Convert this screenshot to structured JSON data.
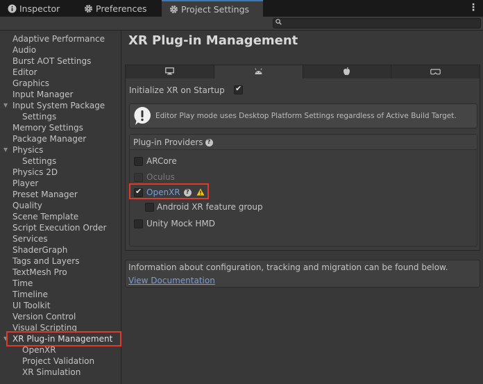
{
  "tabs": [
    {
      "label": "Inspector",
      "icon": "info-icon",
      "active": false
    },
    {
      "label": "Preferences",
      "icon": "gear-icon",
      "active": false
    },
    {
      "label": "Project Settings",
      "icon": "gear-icon",
      "active": true
    }
  ],
  "tab_menu": "⋮",
  "search": {
    "placeholder": "",
    "value": ""
  },
  "sidebar": {
    "items": [
      {
        "label": "Adaptive Performance"
      },
      {
        "label": "Audio"
      },
      {
        "label": "Burst AOT Settings"
      },
      {
        "label": "Editor"
      },
      {
        "label": "Graphics"
      },
      {
        "label": "Input Manager"
      },
      {
        "label": "Input System Package",
        "expanded": true
      },
      {
        "label": "Settings"
      },
      {
        "label": "Memory Settings"
      },
      {
        "label": "Package Manager"
      },
      {
        "label": "Physics",
        "expanded": true
      },
      {
        "label": "Settings"
      },
      {
        "label": "Physics 2D"
      },
      {
        "label": "Player"
      },
      {
        "label": "Preset Manager"
      },
      {
        "label": "Quality"
      },
      {
        "label": "Scene Template"
      },
      {
        "label": "Script Execution Order"
      },
      {
        "label": "Services"
      },
      {
        "label": "ShaderGraph"
      },
      {
        "label": "Tags and Layers"
      },
      {
        "label": "TextMesh Pro"
      },
      {
        "label": "Time"
      },
      {
        "label": "Timeline"
      },
      {
        "label": "UI Toolkit"
      },
      {
        "label": "Version Control"
      },
      {
        "label": "Visual Scripting"
      },
      {
        "label": "XR Plug-in Management",
        "expanded": true,
        "selected": true
      },
      {
        "label": "OpenXR"
      },
      {
        "label": "Project Validation"
      },
      {
        "label": "XR Simulation"
      }
    ]
  },
  "main": {
    "title": "XR Plug-in Management",
    "platform_tabs": [
      {
        "icon": "desktop-icon",
        "active": false
      },
      {
        "icon": "android-icon",
        "active": true
      },
      {
        "icon": "apple-icon",
        "active": false
      },
      {
        "icon": "vr-headset-icon",
        "active": false
      }
    ],
    "init_label": "Initialize XR on Startup",
    "init_checked": true,
    "help_message": "Editor Play mode uses Desktop Platform Settings regardless of Active Build Target.",
    "providers_title": "Plug-in Providers",
    "providers": [
      {
        "label": "ARCore",
        "checked": false,
        "disabled": false
      },
      {
        "label": "Oculus",
        "checked": false,
        "disabled": true
      },
      {
        "label": "OpenXR",
        "checked": true,
        "disabled": false
      },
      {
        "label": "Android XR feature group",
        "checked": false,
        "disabled": false
      },
      {
        "label": "Unity Mock HMD",
        "checked": false,
        "disabled": false
      }
    ],
    "info_text": "Information about configuration, tracking and migration can be found below.",
    "info_link": "View Documentation",
    "warning_color": "#f0c419",
    "accent_color": "#3a79bb",
    "highlight_color": "#e03a2c"
  }
}
